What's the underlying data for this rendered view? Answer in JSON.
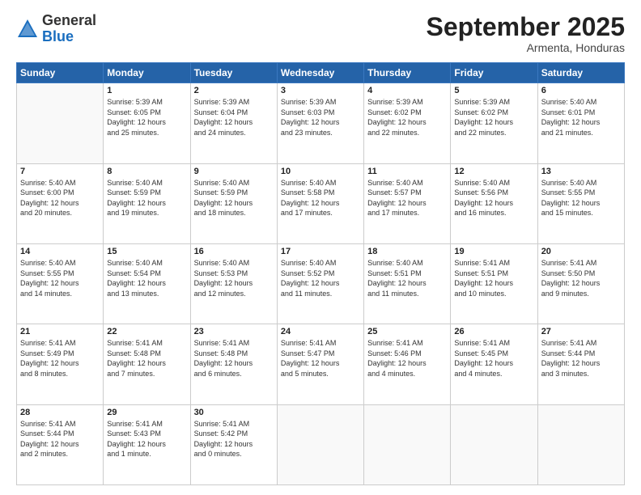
{
  "header": {
    "logo_general": "General",
    "logo_blue": "Blue",
    "month_title": "September 2025",
    "location": "Armenta, Honduras"
  },
  "weekdays": [
    "Sunday",
    "Monday",
    "Tuesday",
    "Wednesday",
    "Thursday",
    "Friday",
    "Saturday"
  ],
  "weeks": [
    [
      {
        "day": "",
        "info": ""
      },
      {
        "day": "1",
        "info": "Sunrise: 5:39 AM\nSunset: 6:05 PM\nDaylight: 12 hours\nand 25 minutes."
      },
      {
        "day": "2",
        "info": "Sunrise: 5:39 AM\nSunset: 6:04 PM\nDaylight: 12 hours\nand 24 minutes."
      },
      {
        "day": "3",
        "info": "Sunrise: 5:39 AM\nSunset: 6:03 PM\nDaylight: 12 hours\nand 23 minutes."
      },
      {
        "day": "4",
        "info": "Sunrise: 5:39 AM\nSunset: 6:02 PM\nDaylight: 12 hours\nand 22 minutes."
      },
      {
        "day": "5",
        "info": "Sunrise: 5:39 AM\nSunset: 6:02 PM\nDaylight: 12 hours\nand 22 minutes."
      },
      {
        "day": "6",
        "info": "Sunrise: 5:40 AM\nSunset: 6:01 PM\nDaylight: 12 hours\nand 21 minutes."
      }
    ],
    [
      {
        "day": "7",
        "info": "Sunrise: 5:40 AM\nSunset: 6:00 PM\nDaylight: 12 hours\nand 20 minutes."
      },
      {
        "day": "8",
        "info": "Sunrise: 5:40 AM\nSunset: 5:59 PM\nDaylight: 12 hours\nand 19 minutes."
      },
      {
        "day": "9",
        "info": "Sunrise: 5:40 AM\nSunset: 5:59 PM\nDaylight: 12 hours\nand 18 minutes."
      },
      {
        "day": "10",
        "info": "Sunrise: 5:40 AM\nSunset: 5:58 PM\nDaylight: 12 hours\nand 17 minutes."
      },
      {
        "day": "11",
        "info": "Sunrise: 5:40 AM\nSunset: 5:57 PM\nDaylight: 12 hours\nand 17 minutes."
      },
      {
        "day": "12",
        "info": "Sunrise: 5:40 AM\nSunset: 5:56 PM\nDaylight: 12 hours\nand 16 minutes."
      },
      {
        "day": "13",
        "info": "Sunrise: 5:40 AM\nSunset: 5:55 PM\nDaylight: 12 hours\nand 15 minutes."
      }
    ],
    [
      {
        "day": "14",
        "info": "Sunrise: 5:40 AM\nSunset: 5:55 PM\nDaylight: 12 hours\nand 14 minutes."
      },
      {
        "day": "15",
        "info": "Sunrise: 5:40 AM\nSunset: 5:54 PM\nDaylight: 12 hours\nand 13 minutes."
      },
      {
        "day": "16",
        "info": "Sunrise: 5:40 AM\nSunset: 5:53 PM\nDaylight: 12 hours\nand 12 minutes."
      },
      {
        "day": "17",
        "info": "Sunrise: 5:40 AM\nSunset: 5:52 PM\nDaylight: 12 hours\nand 11 minutes."
      },
      {
        "day": "18",
        "info": "Sunrise: 5:40 AM\nSunset: 5:51 PM\nDaylight: 12 hours\nand 11 minutes."
      },
      {
        "day": "19",
        "info": "Sunrise: 5:41 AM\nSunset: 5:51 PM\nDaylight: 12 hours\nand 10 minutes."
      },
      {
        "day": "20",
        "info": "Sunrise: 5:41 AM\nSunset: 5:50 PM\nDaylight: 12 hours\nand 9 minutes."
      }
    ],
    [
      {
        "day": "21",
        "info": "Sunrise: 5:41 AM\nSunset: 5:49 PM\nDaylight: 12 hours\nand 8 minutes."
      },
      {
        "day": "22",
        "info": "Sunrise: 5:41 AM\nSunset: 5:48 PM\nDaylight: 12 hours\nand 7 minutes."
      },
      {
        "day": "23",
        "info": "Sunrise: 5:41 AM\nSunset: 5:48 PM\nDaylight: 12 hours\nand 6 minutes."
      },
      {
        "day": "24",
        "info": "Sunrise: 5:41 AM\nSunset: 5:47 PM\nDaylight: 12 hours\nand 5 minutes."
      },
      {
        "day": "25",
        "info": "Sunrise: 5:41 AM\nSunset: 5:46 PM\nDaylight: 12 hours\nand 4 minutes."
      },
      {
        "day": "26",
        "info": "Sunrise: 5:41 AM\nSunset: 5:45 PM\nDaylight: 12 hours\nand 4 minutes."
      },
      {
        "day": "27",
        "info": "Sunrise: 5:41 AM\nSunset: 5:44 PM\nDaylight: 12 hours\nand 3 minutes."
      }
    ],
    [
      {
        "day": "28",
        "info": "Sunrise: 5:41 AM\nSunset: 5:44 PM\nDaylight: 12 hours\nand 2 minutes."
      },
      {
        "day": "29",
        "info": "Sunrise: 5:41 AM\nSunset: 5:43 PM\nDaylight: 12 hours\nand 1 minute."
      },
      {
        "day": "30",
        "info": "Sunrise: 5:41 AM\nSunset: 5:42 PM\nDaylight: 12 hours\nand 0 minutes."
      },
      {
        "day": "",
        "info": ""
      },
      {
        "day": "",
        "info": ""
      },
      {
        "day": "",
        "info": ""
      },
      {
        "day": "",
        "info": ""
      }
    ]
  ]
}
